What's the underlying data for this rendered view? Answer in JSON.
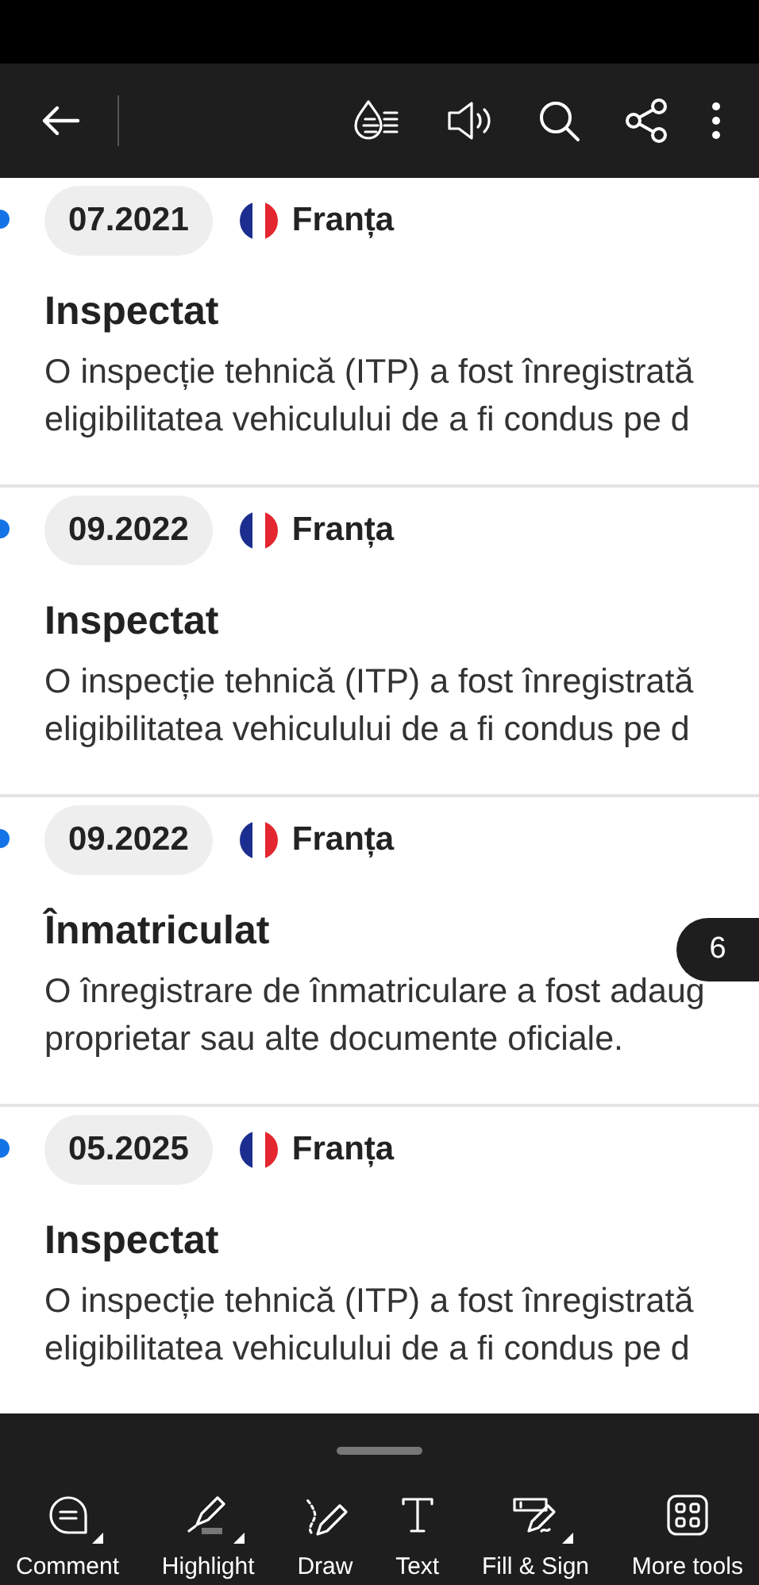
{
  "entries": [
    {
      "date": "07.2021",
      "country": "Franța",
      "title": "Inspectat",
      "lines": [
        "O inspecție tehnică (ITP) a fost înregistrată",
        "eligibilitatea vehiculului de a fi condus pe d"
      ]
    },
    {
      "date": "09.2022",
      "country": "Franța",
      "title": "Inspectat",
      "lines": [
        "O inspecție tehnică (ITP) a fost înregistrată",
        "eligibilitatea vehiculului de a fi condus pe d"
      ]
    },
    {
      "date": "09.2022",
      "country": "Franța",
      "title": "Înmatriculat",
      "lines": [
        "O înregistrare de înmatriculare a fost adaug",
        "proprietar sau alte documente oficiale."
      ]
    },
    {
      "date": "05.2025",
      "country": "Franța",
      "title": "Inspectat",
      "lines": [
        "O inspecție tehnică (ITP) a fost înregistrată",
        "eligibilitatea vehiculului de a fi condus pe d"
      ]
    }
  ],
  "page_number": "6",
  "tools": [
    {
      "kind": "comment",
      "label": "Comment",
      "menu": true
    },
    {
      "kind": "highlight",
      "label": "Highlight",
      "menu": true
    },
    {
      "kind": "draw",
      "label": "Draw",
      "menu": false
    },
    {
      "kind": "text",
      "label": "Text",
      "menu": false
    },
    {
      "kind": "sign",
      "label": "Fill & Sign",
      "menu": true
    },
    {
      "kind": "more",
      "label": "More tools",
      "menu": false
    }
  ]
}
